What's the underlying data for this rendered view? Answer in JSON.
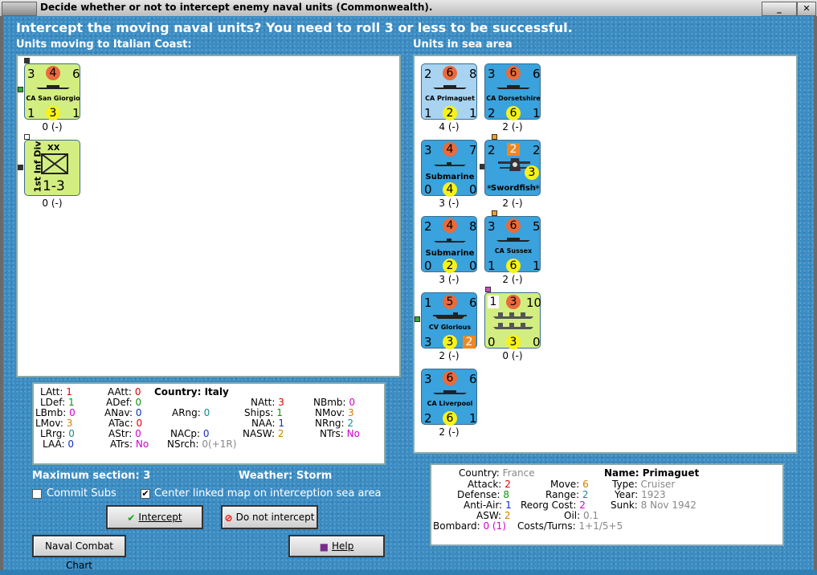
{
  "window": {
    "title": "Decide whether or not to intercept enemy naval units (Commonwealth)."
  },
  "heading": "Intercept the moving naval units?  You need to roll 3 or less to be successful.",
  "left_label": "Units moving to Italian Coast:",
  "right_label": "Units in sea area",
  "moving_units": [
    {
      "name": "CA San Giorgio",
      "top": [
        "3",
        "4",
        "6"
      ],
      "bottom": [
        "1",
        "3",
        "1"
      ],
      "status": "0 (-)"
    },
    {
      "name": "1st Inf Div",
      "size": "XX",
      "value": "1-3",
      "status": "0 (-)"
    }
  ],
  "sea_units": [
    {
      "name": "CA Primaguet",
      "top": [
        "2",
        "6",
        "8"
      ],
      "bottom": [
        "1",
        "2",
        "1"
      ],
      "status": "4 (-)"
    },
    {
      "name": "CA Dorsetshire",
      "top": [
        "3",
        "6",
        "6"
      ],
      "bottom": [
        "2",
        "6",
        "1"
      ],
      "status": "2 (-)"
    },
    {
      "name": "Submarine",
      "top": [
        "3",
        "4",
        "7"
      ],
      "bottom": [
        "0",
        "4",
        "0"
      ],
      "status": "3 (-)"
    },
    {
      "name": "Swordfish",
      "top": [
        "2",
        "2",
        "2"
      ],
      "circle": "3",
      "stars": [
        "*",
        "*"
      ],
      "status": "2 (-)"
    },
    {
      "name": "Submarine",
      "top": [
        "2",
        "4",
        "8"
      ],
      "bottom": [
        "0",
        "2",
        "0"
      ],
      "status": "3 (-)"
    },
    {
      "name": "CA Sussex",
      "top": [
        "3",
        "6",
        "5"
      ],
      "bottom": [
        "1",
        "6",
        "1"
      ],
      "status": "2 (-)"
    },
    {
      "name": "CV Glorious",
      "top": [
        "1",
        "5",
        "6"
      ],
      "bottom": [
        "3",
        "3",
        "2"
      ],
      "status": "2 (-)"
    },
    {
      "name": "Convoy",
      "top": [
        "1",
        "3",
        "10"
      ],
      "bottom": [
        "0",
        "3",
        "0"
      ],
      "status": "0 (-)"
    },
    {
      "name": "CA Liverpool",
      "top": [
        "3",
        "6",
        "6"
      ],
      "bottom": [
        "2",
        "6",
        "1"
      ],
      "status": "2 (-)"
    }
  ],
  "stats_box": {
    "country_label": "Country: Italy",
    "col1": [
      [
        "LAtt:",
        "1"
      ],
      [
        "LDef:",
        "1"
      ],
      [
        "LBmb:",
        "0"
      ],
      [
        "LMov:",
        "3"
      ],
      [
        "LRrg:",
        "0"
      ],
      [
        "LAA:",
        "0"
      ]
    ],
    "col2": [
      [
        "AAtt:",
        "0"
      ],
      [
        "ADef:",
        "0"
      ],
      [
        "ANav:",
        "0"
      ],
      [
        "ATac:",
        "0"
      ],
      [
        "AStr:",
        "0"
      ],
      [
        "ATrs:",
        "No"
      ]
    ],
    "col3": [
      [
        "ARng:",
        "0"
      ],
      [
        "NACp:",
        "0"
      ],
      [
        "NSrch:",
        "0(+1R)"
      ]
    ],
    "col4": [
      [
        "NAtt:",
        "3"
      ],
      [
        "Ships:",
        "1"
      ],
      [
        "NAA:",
        "1"
      ],
      [
        "NASW:",
        "2"
      ]
    ],
    "col5": [
      [
        "NBmb:",
        "0"
      ],
      [
        "NMov:",
        "3"
      ],
      [
        "NRng:",
        "2"
      ],
      [
        "NTrs:",
        "No"
      ]
    ]
  },
  "max_section": "Maximum section: 3",
  "weather": "Weather:  Storm",
  "commit_subs": {
    "label": "Commit Subs",
    "checked": false
  },
  "center_map": {
    "label": "Center linked map on interception sea area",
    "checked": true
  },
  "buttons": {
    "intercept": "Intercept",
    "not_intercept": "Do not intercept",
    "chart": "Naval Combat Chart",
    "help": "Help"
  },
  "detail": {
    "country_label": "Country:",
    "country": "France",
    "attack_label": "Attack:",
    "attack": "2",
    "defense_label": "Defense:",
    "defense": "8",
    "antiair_label": "Anti-Air:",
    "antiair": "1",
    "asw_label": "ASW:",
    "asw": "2",
    "bombard_label": "Bombard:",
    "bombard": "0",
    "bombard_extra": "(1)",
    "move_label": "Move:",
    "move": "6",
    "range_label": "Range:",
    "range": "2",
    "reorg_label": "Reorg Cost:",
    "reorg": "2",
    "oil_label": "Oil:",
    "oil": "0.1",
    "costs_label": "Costs/Turns:",
    "costs": "1+1/5+5",
    "name_label": "Name: Primaguet",
    "type_label": "Type:",
    "type": "Cruiser",
    "year_label": "Year:",
    "year": "1923",
    "sunk_label": "Sunk:",
    "sunk": "8 Nov 1942"
  }
}
